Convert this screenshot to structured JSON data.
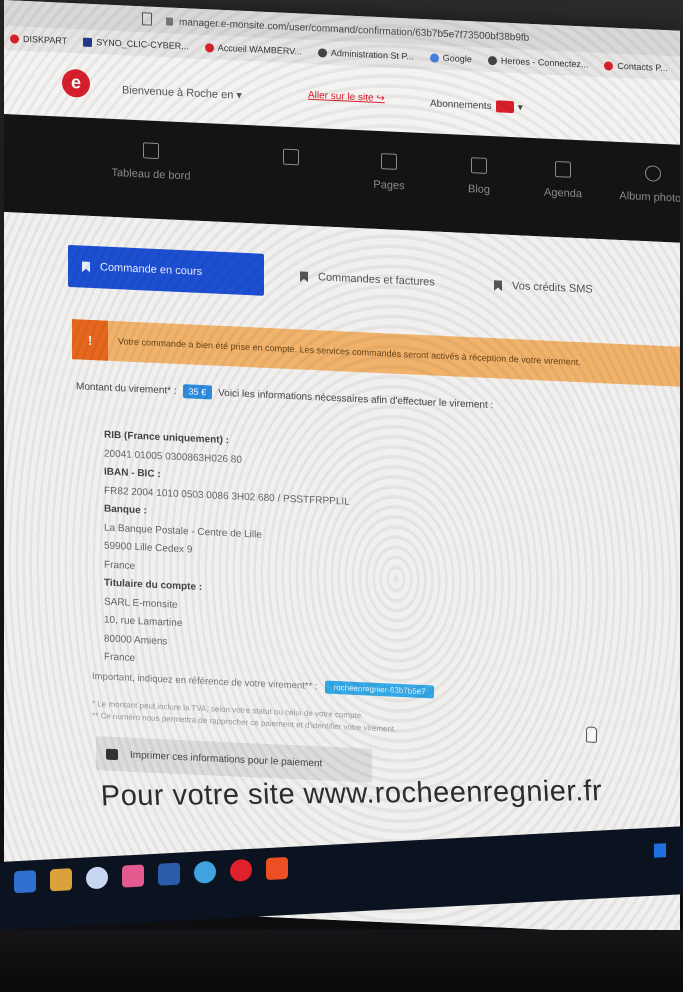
{
  "browser": {
    "url": "manager.e-monsite.com/user/command/confirmation/63b7b5e7f73500bf38b9fb",
    "bookmarks": [
      {
        "label": "DISKPART",
        "color": "#d81f2c"
      },
      {
        "label": "SYNO_CLIC-CYBER...",
        "color": "#233a8a"
      },
      {
        "label": "Accueil WAMBERV...",
        "color": "#d81f2c"
      },
      {
        "label": "Administration St P...",
        "color": "#444444"
      },
      {
        "label": "Google",
        "color": "#4a7fe0"
      },
      {
        "label": "Heroes - Connectez...",
        "color": "#444444"
      },
      {
        "label": "Contacts P...",
        "color": "#d81f2c"
      }
    ]
  },
  "header": {
    "logo_letter": "e",
    "site_select": "Bienvenue à Roche en ▾",
    "goto_site": "Aller sur le site ↪",
    "abonnements": "Abonnements",
    "brand_color": "#d81f2c"
  },
  "nav": {
    "items": [
      {
        "label": "Tableau de bord",
        "icon": "home-icon"
      },
      {
        "label": "",
        "icon": "document-icon"
      },
      {
        "label": "Pages",
        "icon": "page-icon"
      },
      {
        "label": "Blog",
        "icon": "blog-icon"
      },
      {
        "label": "Agenda",
        "icon": "calendar-icon"
      },
      {
        "label": "Album photos",
        "icon": "camera-icon"
      }
    ]
  },
  "tabs": {
    "active": "Commande en cours",
    "orders": "Commandes et factures",
    "sms": "Vos crédits SMS",
    "active_color": "#1d4fd2"
  },
  "alert": {
    "icon": "!",
    "text": "Votre commande a bien été prise en compte. Les services commandés seront activés à réception de votre virement."
  },
  "amount": {
    "label": "Montant du virement* :",
    "value": "35 €",
    "info": "Voici les informations nécessaires afin d'effectuer le virement :"
  },
  "bank": {
    "rib_title": "RIB (France uniquement) :",
    "rib_value": "20041 01005 0300863H026 80",
    "iban_title": "IBAN - BIC :",
    "iban_value": "FR82 2004 1010 0503 0086 3H02 680 / PSSTFRPPLIL",
    "bank_title": "Banque :",
    "bank_lines": [
      "La Banque Postale - Centre de Lille",
      "59900 Lille Cedex 9",
      "France"
    ],
    "holder_title": "Titulaire du compte :",
    "holder_lines": [
      "SARL E-monsite",
      "10, rue Lamartine",
      "80000 Amiens",
      "France"
    ]
  },
  "reference": {
    "label": "Important, indiquez en référence de votre virement** :",
    "value": "rocheenregnier-63b7b5e7"
  },
  "notes": {
    "line1": "* Le montant peut inclure la TVA, selon votre statut ou celui de votre compte.",
    "line2": "** Ce numéro nous permettra de rapprocher ce paiement et d'identifier votre virement."
  },
  "print_button": "Imprimer ces informations pour le paiement",
  "watermark": "Pour votre site www.rocheenregnier.fr",
  "taskbar": {
    "icons": [
      {
        "name": "folder-icon",
        "color": "#2f6fd0"
      },
      {
        "name": "calendar-app-icon",
        "color": "#d9a23a"
      },
      {
        "name": "security-app-icon",
        "color": "#c8d6f2"
      },
      {
        "name": "photos-app-icon",
        "color": "#e25a8e"
      },
      {
        "name": "document-app-icon",
        "color": "#2a5caa"
      },
      {
        "name": "edge-browser-icon",
        "color": "#3fa3e0"
      },
      {
        "name": "opera-browser-icon",
        "color": "#e0202a"
      },
      {
        "name": "brave-browser-icon",
        "color": "#ec4f24"
      }
    ]
  }
}
